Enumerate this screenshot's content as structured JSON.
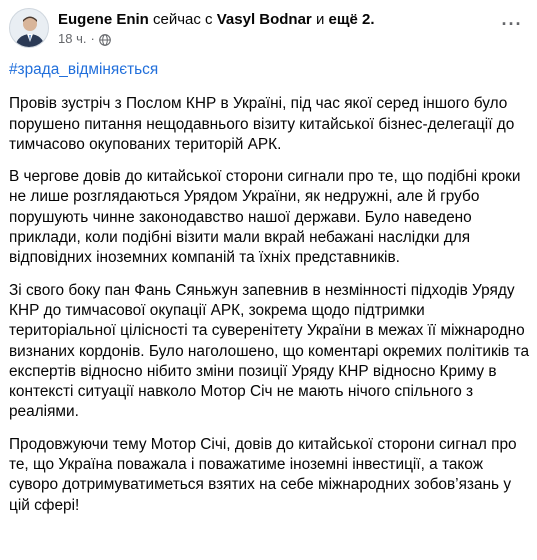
{
  "header": {
    "author": "Eugene Enin",
    "with_text": "сейчас с",
    "tagged": "Vasyl Bodnar",
    "and_text": "и",
    "others": "ещё 2.",
    "time": "18 ч.",
    "dot": "·",
    "privacy_icon": "globe-icon",
    "more_icon": "more-options-icon",
    "more_glyph": "···"
  },
  "post": {
    "hashtag": "#зрада_відміняється",
    "paragraphs": [
      "Провів зустріч з Послом КНР в Україні, під час якої серед іншого було порушено питання  нещодавнього візиту китайської бізнес-делегації до тимчасово окупованих територій АРК.",
      "В чергове довів до китайської сторони сигнали про те, що подібні кроки не лише розглядаються Урядом України, як недружні, але й грубо порушують чинне законодавство нашої держави. Було наведено приклади, коли подібні візити мали вкрай небажані наслідки для відповідних іноземних компаній та їхніх представників.",
      "Зі свого боку пан Фань Сяньжун запевнив в незмінності підходів Уряду КНР до тимчасової окупації АРК, зокрема щодо підтримки територіальної цілісності та суверенітету України в межах її міжнародно визнаних кордонів. Було наголошено, що коментарі окремих політиків та експертів відносно нібито зміни позиції Уряду КНР відносно Криму в контексті ситуації навколо Мотор Січ не мають нічого спільного з реаліями.",
      "Продовжуючи тему Мотор Січі, довів до китайської сторони сигнал про те, що Україна поважала і поважатиме іноземні інвестиції, а також суворо дотримуватиметься взятих на себе міжнародних зобов’язань у цій сфері!"
    ]
  },
  "colors": {
    "hashtag": "#216fdb",
    "secondary_text": "#65676b",
    "text": "#050505"
  }
}
